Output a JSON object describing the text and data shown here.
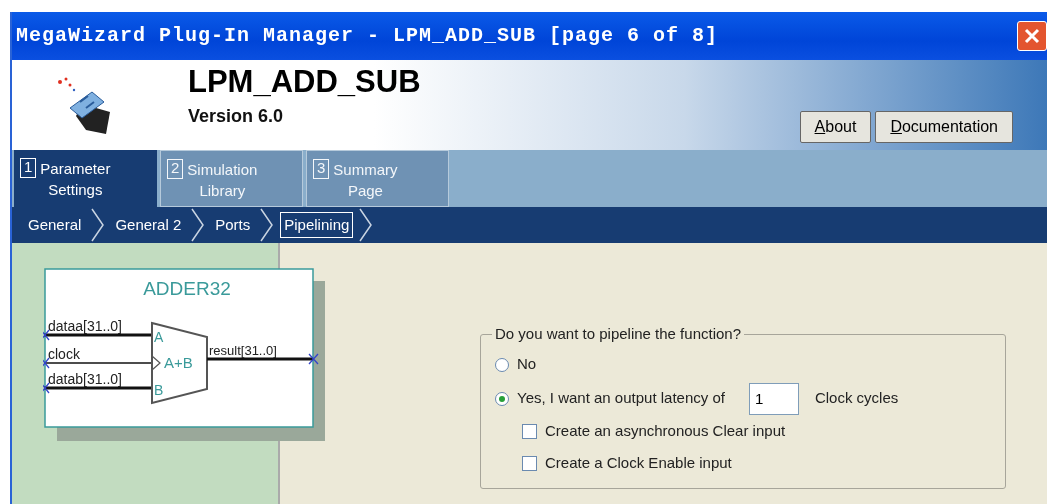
{
  "window": {
    "title": "MegaWizard Plug-In Manager - LPM_ADD_SUB [page 6 of 8]"
  },
  "header": {
    "title": "LPM_ADD_SUB",
    "version": "Version 6.0",
    "buttons": [
      {
        "label": "About",
        "mnemonic": true
      },
      {
        "label": "Documentation",
        "mnemonic": true
      }
    ]
  },
  "tabs": [
    {
      "number": "1",
      "lines": [
        "Parameter",
        "Settings"
      ],
      "selected": true
    },
    {
      "number": "2",
      "lines": [
        "Simulation",
        "Library"
      ],
      "selected": false
    },
    {
      "number": "3",
      "lines": [
        "Summary",
        "Page"
      ],
      "selected": false
    }
  ],
  "breadcrumb": [
    {
      "label": "General",
      "selected": false
    },
    {
      "label": "General 2",
      "selected": false
    },
    {
      "label": "Ports",
      "selected": false
    },
    {
      "label": "Pipelining",
      "selected": true
    }
  ],
  "diagram": {
    "title": "ADDER32",
    "inputs": [
      {
        "name": "dataa[31..0]",
        "kind": "bus",
        "port": "A"
      },
      {
        "name": "clock",
        "kind": "clock"
      },
      {
        "name": "datab[31..0]",
        "kind": "bus",
        "port": "B"
      }
    ],
    "operation": "A+B",
    "output": "result[31..0]"
  },
  "pipeline": {
    "question": "Do you want to pipeline the function?",
    "options": [
      {
        "label": "No",
        "selected": false
      },
      {
        "label": "Yes, I want an output latency of",
        "selected": true,
        "value": "1",
        "unit": "Clock cycles"
      }
    ],
    "checkboxes": [
      {
        "label": "Create an asynchronous Clear input",
        "checked": false
      },
      {
        "label": "Create a Clock Enable input",
        "checked": false
      }
    ]
  }
}
